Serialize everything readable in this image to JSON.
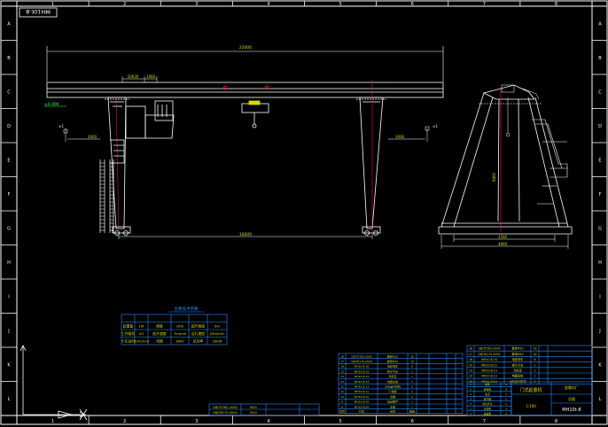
{
  "drawing": {
    "title_stamp": "MH10t-8",
    "drawing_number": "MH10t-8"
  },
  "frame": {
    "columns": [
      "1",
      "2",
      "3",
      "4",
      "5",
      "6",
      "7",
      "8"
    ],
    "rows": [
      "A",
      "B",
      "C",
      "D",
      "E",
      "F",
      "G",
      "H",
      "I",
      "J",
      "K",
      "L"
    ]
  },
  "front_view": {
    "dim_total": "22000",
    "dim_leg_top": "10630",
    "dim_small": "1900",
    "dim_outrigger_left": "3000",
    "dim_outrigger_right": "3000",
    "dim_span": "16000",
    "level_label": "±0.000",
    "left_marker": "±1",
    "right_marker": "±1"
  },
  "side_view": {
    "dim_height": "9800",
    "dim_base_inner": "3500",
    "dim_base_outer": "4800"
  },
  "spec_table": {
    "title": "主要技术参数",
    "rows": [
      [
        "起重量",
        "10t",
        "跨度",
        "16m",
        "起升高度",
        "9m"
      ],
      [
        "工作级别",
        "A3",
        "起升速度",
        "7m/min",
        "运行速度",
        "20m/min"
      ],
      [
        "小车运行",
        "20m/min",
        "电源",
        "380V",
        "总功率",
        "18kW"
      ]
    ]
  },
  "parts_list": {
    "rows": [
      [
        "18",
        "GB/T5782-2000",
        "螺栓M20",
        "16"
      ],
      [
        "17",
        "GB/T6170-2000",
        "螺母M20",
        "16"
      ],
      [
        "16",
        "MH10-8.16",
        "电缆滑车",
        "6"
      ],
      [
        "15",
        "MH10-8.15",
        "梯子平台",
        "1"
      ],
      [
        "14",
        "MH10-8.14",
        "司机室",
        "1"
      ],
      [
        "13",
        "MH10-8.13",
        "电器系统",
        "1"
      ],
      [
        "12",
        "MH10-8.12",
        "大车运行机构",
        "2"
      ],
      [
        "11",
        "MH10-8.11",
        "下横梁",
        "2"
      ],
      [
        "10",
        "MH10-8.10",
        "支腿",
        "4"
      ],
      [
        "9",
        "MH10-8.09",
        "电动葫芦",
        "1"
      ],
      [
        "8",
        "MH10-8.08",
        "主梁",
        "1"
      ]
    ],
    "footer": [
      "序号",
      "代号",
      "名称",
      "数量"
    ]
  },
  "title_block": {
    "left_rows": [
      [
        "7",
        "MH10-8.07",
        "端梁",
        "2"
      ],
      [
        "6",
        "MH10-8.06",
        "连接板",
        "4"
      ],
      [
        "5",
        "MH10-8.05",
        "轨道",
        "2"
      ],
      [
        "4",
        "MH10-8.04",
        "缓冲器",
        "4"
      ],
      [
        "3",
        "MH10-8.03",
        "限位开关",
        "2"
      ],
      [
        "2",
        "MH10-8.02",
        "车轮组",
        "4"
      ],
      [
        "1",
        "MH10-8.01",
        "减速机",
        "2"
      ]
    ],
    "drawing_name": "门式起重机",
    "drawing_name_sub": "总图",
    "company": "起重机厂",
    "scale": "1:100"
  },
  "bottom_notes": [
    "GB/T5782-2000",
    "GB/T6170-2000",
    "M20",
    "M20"
  ],
  "colors": {
    "frame": "#ffffff",
    "line": "#ffffff",
    "dim": "#d8d800",
    "centerline": "#ff2020",
    "table": "#2a8cff",
    "accent": "#00ffff",
    "green": "#40ff40"
  }
}
